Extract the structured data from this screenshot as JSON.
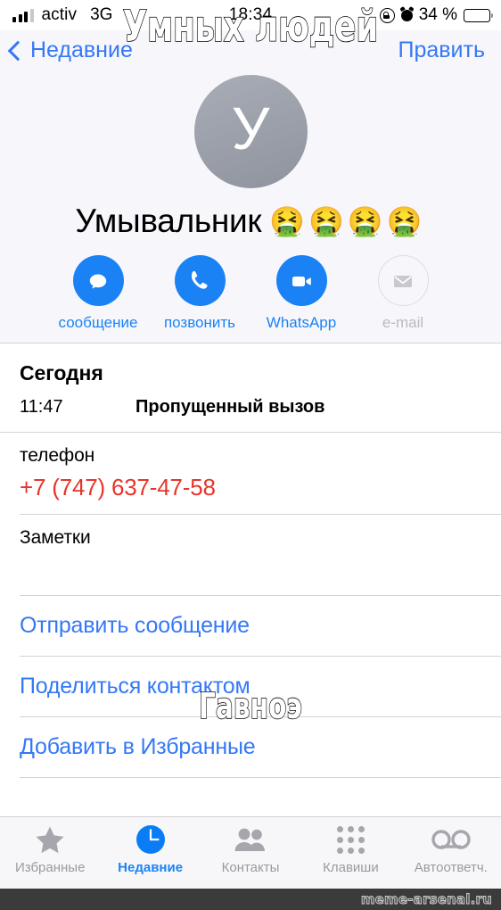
{
  "status_bar": {
    "carrier": "activ",
    "network": "3G",
    "time": "18:34",
    "battery_percent": "34 %",
    "signal_bars_filled": 3,
    "signal_bars_total": 4,
    "icons": [
      "rotation-lock-icon",
      "alarm-icon",
      "battery-icon"
    ]
  },
  "nav_bar": {
    "back_label": "Недавние",
    "edit_label": "Править"
  },
  "contact": {
    "avatar_initial": "У",
    "name": "Умывальник",
    "emoji": "🤮🤮🤮🤮",
    "actions": [
      {
        "label": "сообщение",
        "icon": "message-bubble-icon",
        "enabled": true
      },
      {
        "label": "позвонить",
        "icon": "phone-handset-icon",
        "enabled": true
      },
      {
        "label": "WhatsApp",
        "icon": "video-camera-icon",
        "enabled": true
      },
      {
        "label": "e-mail",
        "icon": "envelope-icon",
        "enabled": false
      }
    ]
  },
  "call_log": {
    "day": "Сегодня",
    "time": "11:47",
    "type": "Пропущенный вызов"
  },
  "fields": [
    {
      "label": "телефон",
      "value": "+7 (747) 637-47-58"
    },
    {
      "label": "Заметки",
      "value": ""
    }
  ],
  "links": [
    "Отправить сообщение",
    "Поделиться контактом",
    "Добавить в Избранные"
  ],
  "tab_bar": [
    {
      "label": "Избранные",
      "icon": "star-icon",
      "active": false
    },
    {
      "label": "Недавние",
      "icon": "clock-icon",
      "active": true
    },
    {
      "label": "Контакты",
      "icon": "people-icon",
      "active": false
    },
    {
      "label": "Клавиши",
      "icon": "keypad-icon",
      "active": false
    },
    {
      "label": "Автоответч.",
      "icon": "voicemail-icon",
      "active": false
    }
  ],
  "overlays": {
    "top_caption": "Умных людей",
    "middle_caption": "Гавноэ",
    "watermark": "meme-arsenal.ru"
  },
  "colors": {
    "accent_blue": "#1b82f5",
    "link_blue": "#3478f6",
    "phone_red": "#e8342a",
    "header_bg": "#f7f7fb",
    "inactive_gray": "#9a9aa0"
  }
}
